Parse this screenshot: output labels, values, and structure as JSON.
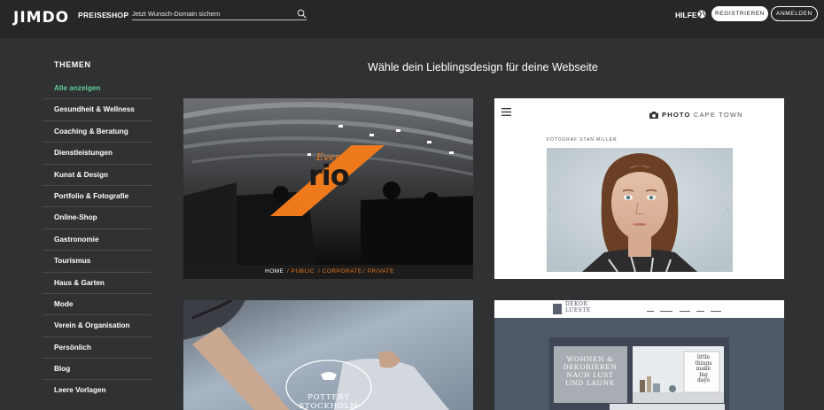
{
  "topbar": {
    "logo": "JIMDO",
    "nav": {
      "preise": "PREISE",
      "shop": "SHOP"
    },
    "search": {
      "placeholder": "Jetzt Wunsch-Domain sichern"
    },
    "help": "HILFE",
    "register": "REGISTRIEREN",
    "login": "ANMELDEN"
  },
  "sidebar": {
    "title": "THEMEN",
    "items": [
      "Alle anzeigen",
      "Gesundheit & Wellness",
      "Coaching & Beratung",
      "Dienstleistungen",
      "Kunst & Design",
      "Portfolio & Fotografie",
      "Online-Shop",
      "Gastronomie",
      "Tourismus",
      "Haus & Garten",
      "Mode",
      "Verein & Organisation",
      "Persönlich",
      "Blog",
      "Leere Vorlagen"
    ]
  },
  "main": {
    "title": "Wähle dein Lieblingsdesign für deine Webseite",
    "templates": {
      "rio": {
        "logo_script": "Events",
        "logo_main": "rio",
        "nav": [
          "HOME",
          "/ PUBLIC",
          "/ CORPORATE",
          "/ PRIVATE"
        ]
      },
      "capetown": {
        "brand_bold": "PHOTO",
        "brand_light": "CAPE TOWN",
        "photographer": "FOTOGRAF STAN MILLER"
      },
      "stockholm": {
        "brand": "POTTERY STOCKHOLM"
      },
      "dekor": {
        "logo_line1": "DEKOR",
        "logo_line2": "LUESTE",
        "hero": [
          "WOHNEN &",
          "DEKORIEREN",
          "NACH LUST",
          "UND LAUNE"
        ],
        "frame_text": [
          "little",
          "things",
          "make",
          "big",
          "days"
        ]
      }
    }
  },
  "colors": {
    "page_bg": "#303132",
    "topbar_bg": "#262727",
    "active_category": "#5fd09b",
    "rio_accent": "#f07a1a"
  }
}
